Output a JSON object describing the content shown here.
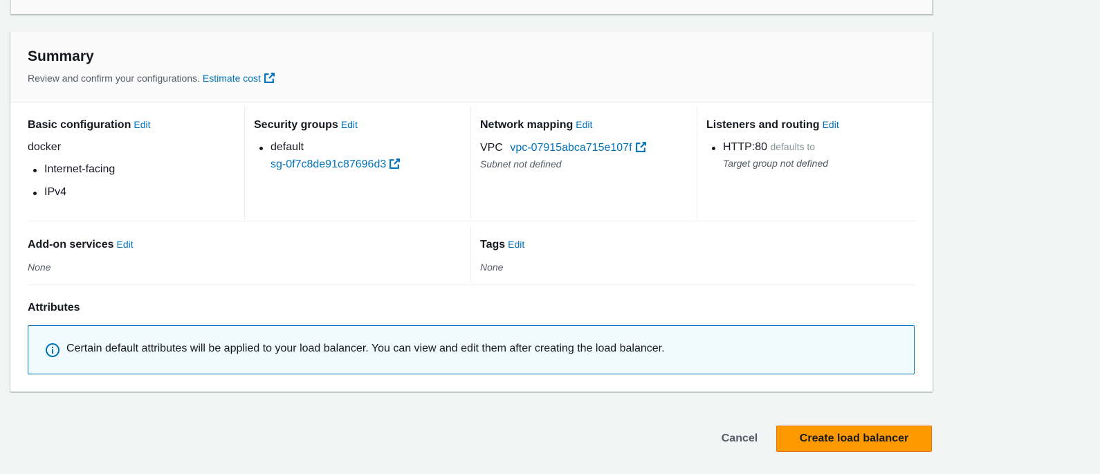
{
  "summary": {
    "title": "Summary",
    "description": "Review and confirm your configurations.",
    "estimate_cost_label": "Estimate cost",
    "edit_label": "Edit",
    "basic_configuration": {
      "title": "Basic configuration",
      "name": "docker",
      "items": [
        "Internet-facing",
        "IPv4"
      ]
    },
    "security_groups": {
      "title": "Security groups",
      "group_name": "default",
      "group_id": "sg-0f7c8de91c87696d3"
    },
    "network_mapping": {
      "title": "Network mapping",
      "vpc_label": "VPC",
      "vpc_id": "vpc-07915abca715e107f",
      "subnet_text": "Subnet not defined"
    },
    "listeners": {
      "title": "Listeners and routing",
      "listener": "HTTP:80",
      "defaults_to": "defaults to",
      "target_text": "Target group not defined"
    },
    "addon_services": {
      "title": "Add-on services",
      "value": "None"
    },
    "tags": {
      "title": "Tags",
      "value": "None"
    },
    "attributes": {
      "title": "Attributes",
      "info_text": "Certain default attributes will be applied to your load balancer. You can view and edit them after creating the load balancer."
    }
  },
  "actions": {
    "cancel_label": "Cancel",
    "create_label": "Create load balancer"
  },
  "colors": {
    "link": "#0073bb",
    "primary_button": "#ff9900",
    "info_border": "#0073bb",
    "info_background": "#f1faff"
  }
}
